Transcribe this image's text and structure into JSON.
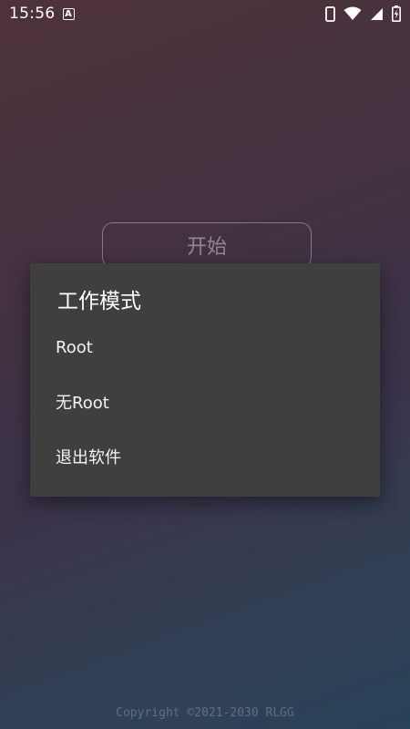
{
  "status_bar": {
    "time": "15:56",
    "notification_letter": "A"
  },
  "main": {
    "start_label": "开始"
  },
  "dialog": {
    "title": "工作模式",
    "items": [
      {
        "label": "Root"
      },
      {
        "label": "无Root"
      },
      {
        "label": "退出软件"
      }
    ]
  },
  "footer": {
    "copyright": "Copyright ©2021-2030 RLGG"
  },
  "colors": {
    "dialog_bg": "#3f3f3f",
    "gradient_top": "#5a3a42",
    "gradient_bottom": "#2f4d66"
  },
  "icons": {
    "status_left": [
      "notification-a-icon"
    ],
    "status_right": [
      "phone-icon",
      "wifi-icon",
      "cell-signal-icon",
      "battery-charging-icon"
    ]
  }
}
